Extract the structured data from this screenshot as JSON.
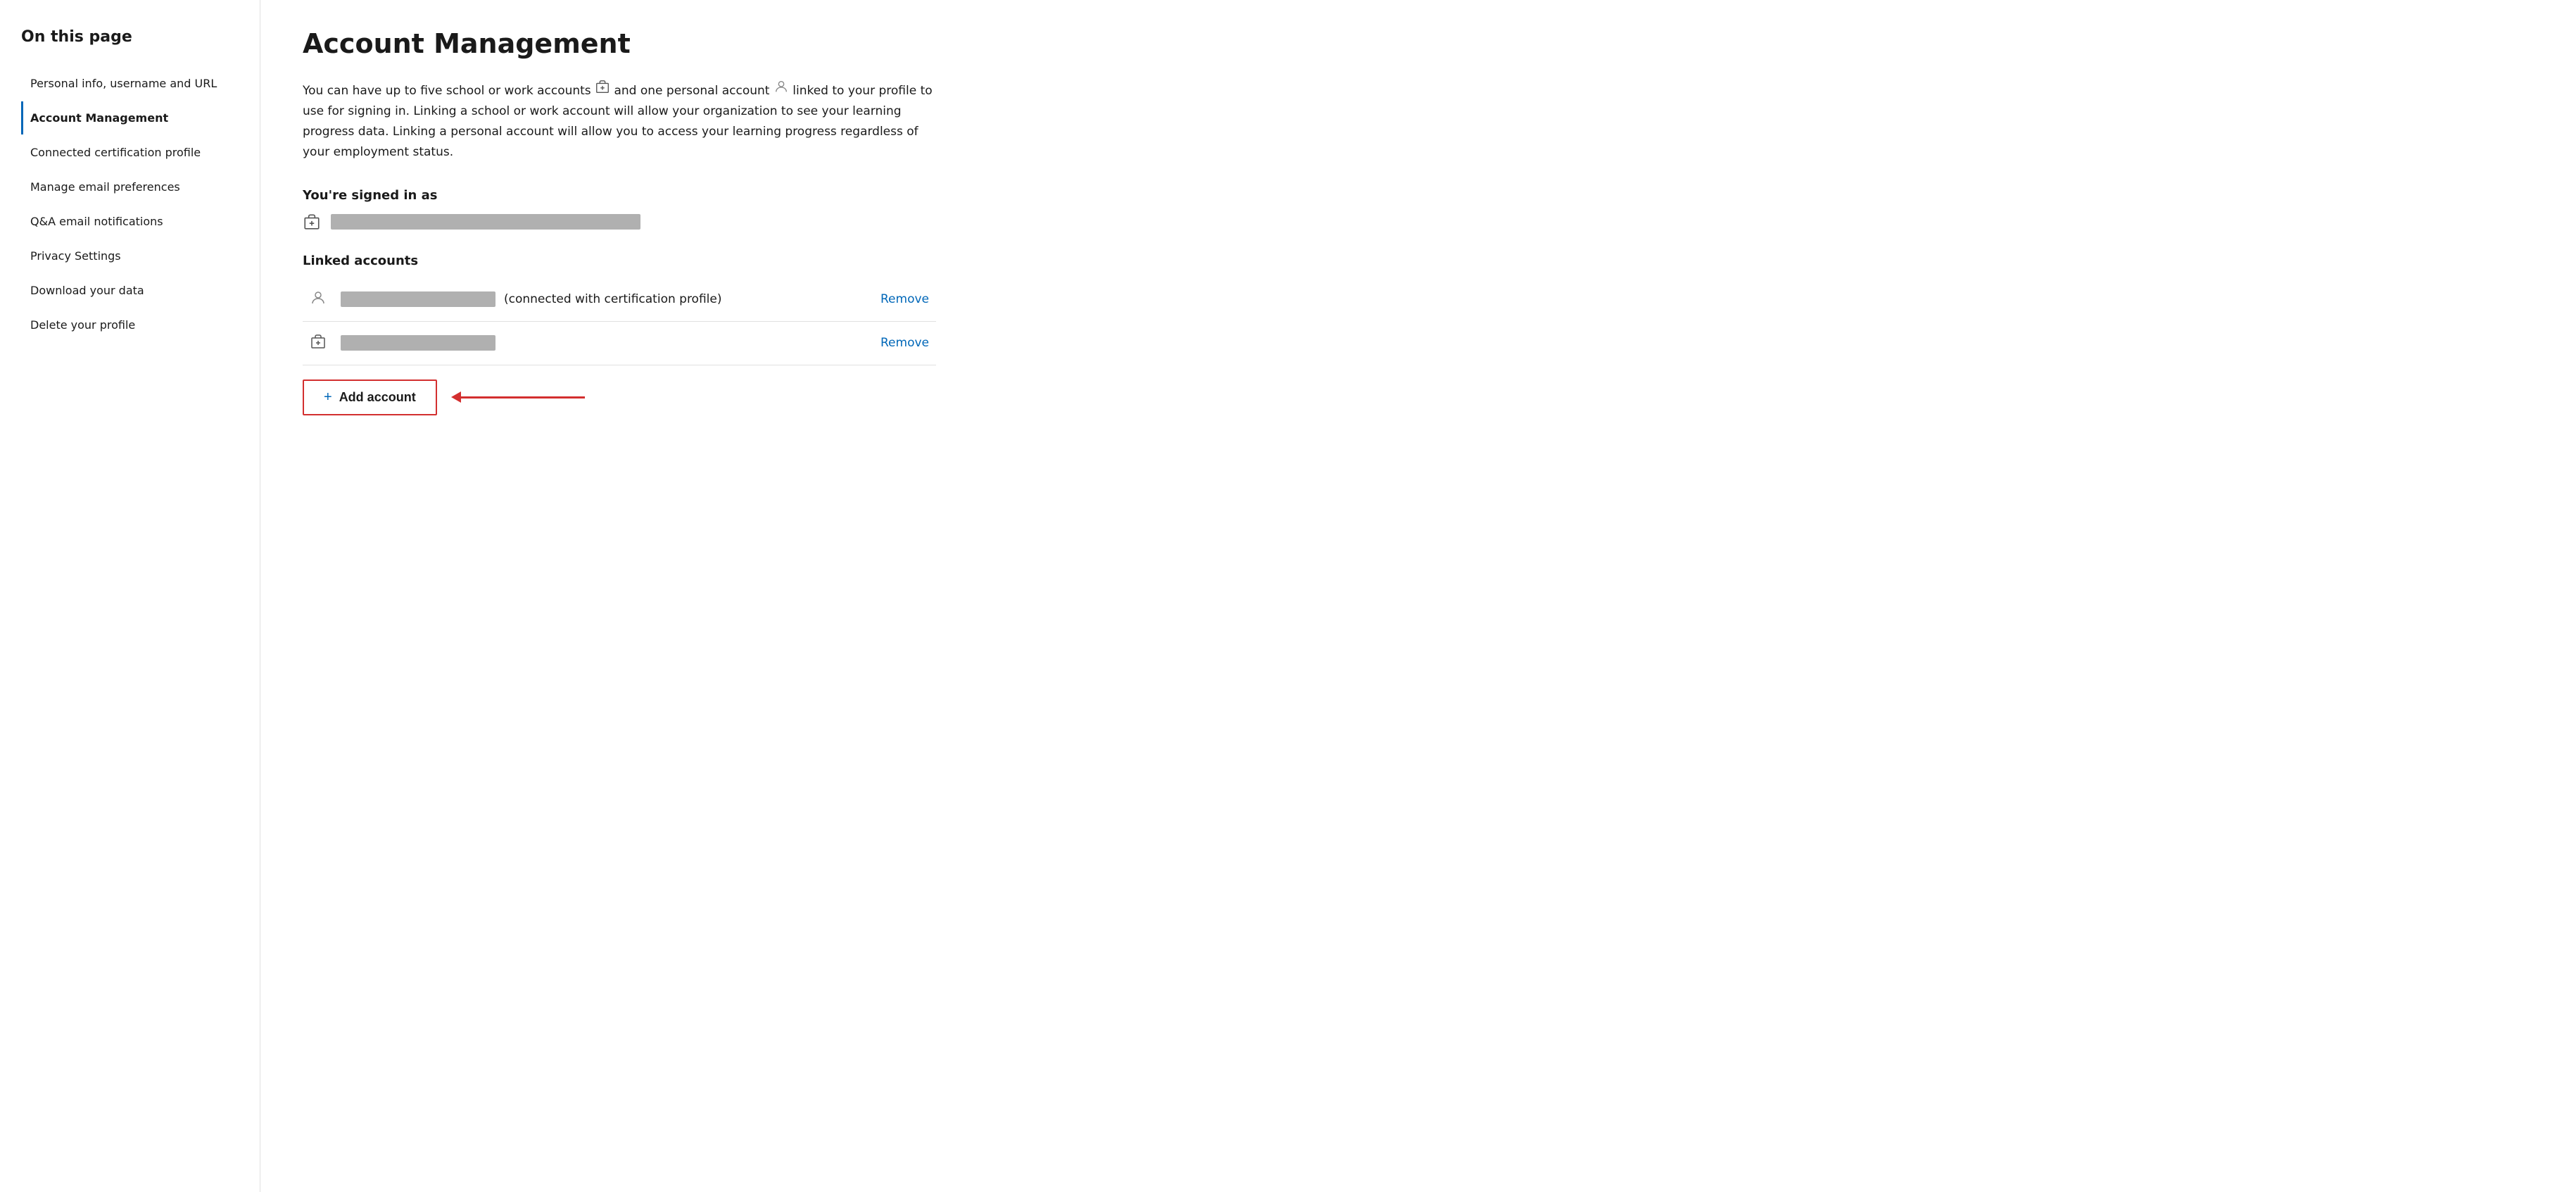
{
  "sidebar": {
    "heading": "On this page",
    "items": [
      {
        "id": "personal-info",
        "label": "Personal info, username and URL",
        "active": false
      },
      {
        "id": "account-management",
        "label": "Account Management",
        "active": true
      },
      {
        "id": "connected-certification",
        "label": "Connected certification profile",
        "active": false
      },
      {
        "id": "manage-email",
        "label": "Manage email preferences",
        "active": false
      },
      {
        "id": "qa-email",
        "label": "Q&A email notifications",
        "active": false
      },
      {
        "id": "privacy-settings",
        "label": "Privacy Settings",
        "active": false
      },
      {
        "id": "download-data",
        "label": "Download your data",
        "active": false
      },
      {
        "id": "delete-profile",
        "label": "Delete your profile",
        "active": false
      }
    ]
  },
  "main": {
    "title": "Account Management",
    "description_part1": "You can have up to five school or work accounts",
    "description_part2": "and one personal account",
    "description_part3": "linked to your profile to use for signing in. Linking a school or work account will allow your organization to see your learning progress data. Linking a personal account will allow you to access your learning progress regardless of your employment status.",
    "signed_in_label": "You're signed in as",
    "linked_accounts_label": "Linked accounts",
    "cert_profile_text": "(connected with certification profile)",
    "remove_label": "Remove",
    "add_account_label": "Add account"
  }
}
